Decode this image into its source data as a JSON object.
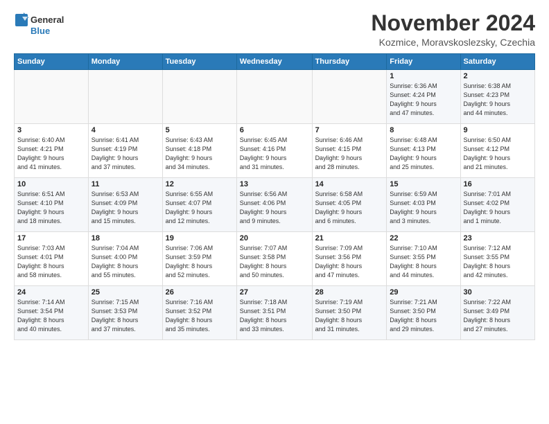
{
  "logo": {
    "line1": "General",
    "line2": "Blue"
  },
  "title": "November 2024",
  "location": "Kozmice, Moravskoslezsky, Czechia",
  "days_of_week": [
    "Sunday",
    "Monday",
    "Tuesday",
    "Wednesday",
    "Thursday",
    "Friday",
    "Saturday"
  ],
  "weeks": [
    [
      {
        "day": "",
        "info": ""
      },
      {
        "day": "",
        "info": ""
      },
      {
        "day": "",
        "info": ""
      },
      {
        "day": "",
        "info": ""
      },
      {
        "day": "",
        "info": ""
      },
      {
        "day": "1",
        "info": "Sunrise: 6:36 AM\nSunset: 4:24 PM\nDaylight: 9 hours\nand 47 minutes."
      },
      {
        "day": "2",
        "info": "Sunrise: 6:38 AM\nSunset: 4:23 PM\nDaylight: 9 hours\nand 44 minutes."
      }
    ],
    [
      {
        "day": "3",
        "info": "Sunrise: 6:40 AM\nSunset: 4:21 PM\nDaylight: 9 hours\nand 41 minutes."
      },
      {
        "day": "4",
        "info": "Sunrise: 6:41 AM\nSunset: 4:19 PM\nDaylight: 9 hours\nand 37 minutes."
      },
      {
        "day": "5",
        "info": "Sunrise: 6:43 AM\nSunset: 4:18 PM\nDaylight: 9 hours\nand 34 minutes."
      },
      {
        "day": "6",
        "info": "Sunrise: 6:45 AM\nSunset: 4:16 PM\nDaylight: 9 hours\nand 31 minutes."
      },
      {
        "day": "7",
        "info": "Sunrise: 6:46 AM\nSunset: 4:15 PM\nDaylight: 9 hours\nand 28 minutes."
      },
      {
        "day": "8",
        "info": "Sunrise: 6:48 AM\nSunset: 4:13 PM\nDaylight: 9 hours\nand 25 minutes."
      },
      {
        "day": "9",
        "info": "Sunrise: 6:50 AM\nSunset: 4:12 PM\nDaylight: 9 hours\nand 21 minutes."
      }
    ],
    [
      {
        "day": "10",
        "info": "Sunrise: 6:51 AM\nSunset: 4:10 PM\nDaylight: 9 hours\nand 18 minutes."
      },
      {
        "day": "11",
        "info": "Sunrise: 6:53 AM\nSunset: 4:09 PM\nDaylight: 9 hours\nand 15 minutes."
      },
      {
        "day": "12",
        "info": "Sunrise: 6:55 AM\nSunset: 4:07 PM\nDaylight: 9 hours\nand 12 minutes."
      },
      {
        "day": "13",
        "info": "Sunrise: 6:56 AM\nSunset: 4:06 PM\nDaylight: 9 hours\nand 9 minutes."
      },
      {
        "day": "14",
        "info": "Sunrise: 6:58 AM\nSunset: 4:05 PM\nDaylight: 9 hours\nand 6 minutes."
      },
      {
        "day": "15",
        "info": "Sunrise: 6:59 AM\nSunset: 4:03 PM\nDaylight: 9 hours\nand 3 minutes."
      },
      {
        "day": "16",
        "info": "Sunrise: 7:01 AM\nSunset: 4:02 PM\nDaylight: 9 hours\nand 1 minute."
      }
    ],
    [
      {
        "day": "17",
        "info": "Sunrise: 7:03 AM\nSunset: 4:01 PM\nDaylight: 8 hours\nand 58 minutes."
      },
      {
        "day": "18",
        "info": "Sunrise: 7:04 AM\nSunset: 4:00 PM\nDaylight: 8 hours\nand 55 minutes."
      },
      {
        "day": "19",
        "info": "Sunrise: 7:06 AM\nSunset: 3:59 PM\nDaylight: 8 hours\nand 52 minutes."
      },
      {
        "day": "20",
        "info": "Sunrise: 7:07 AM\nSunset: 3:58 PM\nDaylight: 8 hours\nand 50 minutes."
      },
      {
        "day": "21",
        "info": "Sunrise: 7:09 AM\nSunset: 3:56 PM\nDaylight: 8 hours\nand 47 minutes."
      },
      {
        "day": "22",
        "info": "Sunrise: 7:10 AM\nSunset: 3:55 PM\nDaylight: 8 hours\nand 44 minutes."
      },
      {
        "day": "23",
        "info": "Sunrise: 7:12 AM\nSunset: 3:55 PM\nDaylight: 8 hours\nand 42 minutes."
      }
    ],
    [
      {
        "day": "24",
        "info": "Sunrise: 7:14 AM\nSunset: 3:54 PM\nDaylight: 8 hours\nand 40 minutes."
      },
      {
        "day": "25",
        "info": "Sunrise: 7:15 AM\nSunset: 3:53 PM\nDaylight: 8 hours\nand 37 minutes."
      },
      {
        "day": "26",
        "info": "Sunrise: 7:16 AM\nSunset: 3:52 PM\nDaylight: 8 hours\nand 35 minutes."
      },
      {
        "day": "27",
        "info": "Sunrise: 7:18 AM\nSunset: 3:51 PM\nDaylight: 8 hours\nand 33 minutes."
      },
      {
        "day": "28",
        "info": "Sunrise: 7:19 AM\nSunset: 3:50 PM\nDaylight: 8 hours\nand 31 minutes."
      },
      {
        "day": "29",
        "info": "Sunrise: 7:21 AM\nSunset: 3:50 PM\nDaylight: 8 hours\nand 29 minutes."
      },
      {
        "day": "30",
        "info": "Sunrise: 7:22 AM\nSunset: 3:49 PM\nDaylight: 8 hours\nand 27 minutes."
      }
    ]
  ]
}
